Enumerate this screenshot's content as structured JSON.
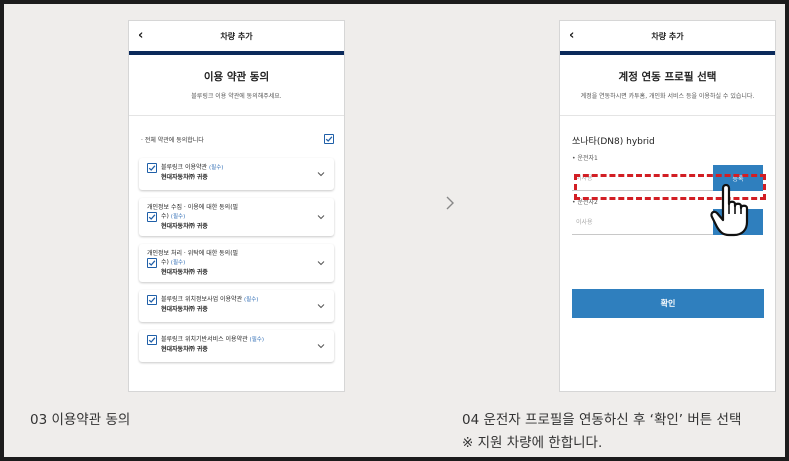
{
  "left_phone": {
    "header_title": "차량 추가",
    "heading": "이용 약관 동의",
    "subheading": "블루링크 이용 약관에 동의해주세요.",
    "agree_all_label": "· 전체 약관에 동의합니다",
    "agree_all_checked": true,
    "terms": [
      {
        "title": "블루링크 이용약관",
        "required": "(필수)",
        "owner": "현대자동차㈜ 귀중",
        "checked": true
      },
      {
        "title_line1": "개인정보 수집 · 이용에 대한 동의(필",
        "title_line2": "수)",
        "required": "(필수)",
        "owner": "현대자동차㈜ 귀중",
        "checked": true
      },
      {
        "title_line1": "개인정보 처리 · 위탁에 대한 동의(필",
        "title_line2": "수)",
        "required": "(필수)",
        "owner": "현대자동차㈜ 귀중",
        "checked": true
      },
      {
        "title": "블루링크 위치정보사업 이용약관",
        "required": "(필수)",
        "owner": "현대자동차㈜ 귀중",
        "checked": true
      },
      {
        "title": "블루링크 위치기반서비스 이용약관",
        "required": "(필수)",
        "owner": "현대자동차㈜ 귀중",
        "checked": true
      }
    ]
  },
  "right_phone": {
    "header_title": "차량 추가",
    "heading": "계정 연동 프로필 선택",
    "subheading": "계정을 연동하시면 카투홈, 개인화 서비스 등을 이용하실 수 있습니다.",
    "car_name": "쏘나타(DN8) hybrid",
    "driver1_label": "• 운전자1",
    "driver1_value": "이사용",
    "driver1_button": "등록",
    "driver2_label": "• 운전자2",
    "driver2_value": "이사용",
    "confirm_button": "확인"
  },
  "captions": {
    "step3": "03 이용약관 동의",
    "step4_line1": "04 운전자 프로필을 연동하신 후 ‘확인’ 버튼 선택",
    "step4_line2": "※ 지원 차량에 한합니다."
  },
  "colors": {
    "header_bar": "#0b2a5b",
    "accent_blue": "#2f7fbe",
    "highlight_red": "#d21e24"
  }
}
